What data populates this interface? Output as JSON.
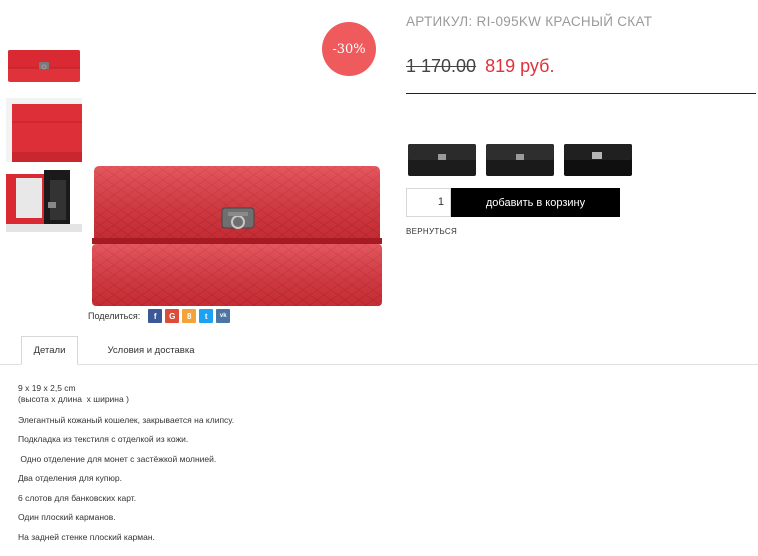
{
  "badge": {
    "discount": "-30%"
  },
  "product": {
    "sku_title": "АРТИКУЛ: RI-095KW КРАСНЫЙ СКАТ",
    "old_price": "1 170.00",
    "new_price": "819 руб.",
    "quantity": "1",
    "add_to_cart": "добавить в корзину",
    "back": "ВЕРНУТЬСЯ"
  },
  "colors": {
    "product_red": "#e0323b",
    "badge": "#ef5a5d",
    "price_new": "#e1313a"
  },
  "gallery": {
    "thumbnails": [
      {
        "name": "red-wallet-front"
      },
      {
        "name": "red-wallet-back"
      },
      {
        "name": "red-wallet-open"
      }
    ],
    "variants": [
      {
        "name": "black-wallet-variant-1"
      },
      {
        "name": "black-wallet-variant-2"
      },
      {
        "name": "black-wallet-variant-3"
      }
    ]
  },
  "share": {
    "label": "Поделиться:",
    "buttons": [
      {
        "icon": "facebook-icon",
        "glyph": "f",
        "color": "#3b5998"
      },
      {
        "icon": "google-plus-icon",
        "glyph": "G",
        "color": "#dd4b39"
      },
      {
        "icon": "odnoklassniki-icon",
        "glyph": "8",
        "color": "#f4a23a"
      },
      {
        "icon": "twitter-icon",
        "glyph": "t",
        "color": "#1da1f2"
      },
      {
        "icon": "vk-icon",
        "glyph": "vk",
        "color": "#4c75a3"
      }
    ]
  },
  "tabs": [
    {
      "label": "Детали",
      "active": true
    },
    {
      "label": "Условия и доставка",
      "active": false
    }
  ],
  "details": {
    "lines": [
      "9 x 19 x 2,5 cm",
      "(высота х длина  х ширина )",
      "Элегантный кожаный кошелек, закрывается на клипсу.",
      "Подкладка из текстиля с отделкой из кожи.",
      " Одно отделение для монет с застёжкой молнией.",
      "Два отделения для купюр.",
      "6 слотов для банковских карт.",
      "Один плоский карманов.",
      "На задней стенке плоский карман."
    ]
  }
}
